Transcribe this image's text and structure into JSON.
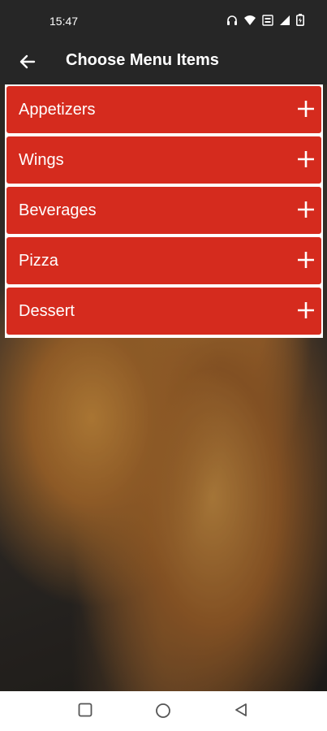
{
  "status_bar": {
    "time": "15:47"
  },
  "app_bar": {
    "title": "Choose Menu Items"
  },
  "menu": {
    "items": [
      {
        "label": "Appetizers"
      },
      {
        "label": "Wings"
      },
      {
        "label": "Beverages"
      },
      {
        "label": "Pizza"
      },
      {
        "label": "Dessert"
      }
    ]
  },
  "colors": {
    "accent": "#d52b1e",
    "bar": "#262626"
  }
}
